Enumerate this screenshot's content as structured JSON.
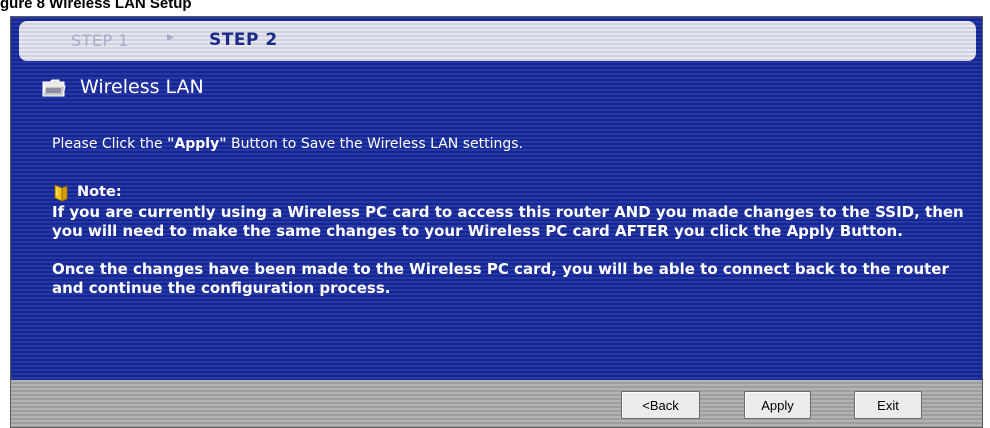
{
  "figure_caption": "gure 8 Wireless LAN Setup",
  "steps": {
    "step1_label": "STEP 1",
    "step2_label": "STEP 2"
  },
  "section": {
    "title": "Wireless LAN",
    "icon": "folder-icon"
  },
  "instruction": {
    "prefix": "Please Click the ",
    "emphasis": "\"Apply\"",
    "suffix": " Button to Save the Wireless LAN settings."
  },
  "note": {
    "icon": "note-icon",
    "label": "Note:",
    "paragraph1": "If you are currently using a Wireless PC card to access this router AND you made changes to the SSID, then you will need to make the same changes to your Wireless PC card AFTER you click the Apply Button.",
    "paragraph2": "Once the changes have been made to the Wireless PC card, you will be able to connect back to the router and continue the configuration process."
  },
  "buttons": {
    "back": "<Back",
    "apply": "Apply",
    "exit": "Exit"
  },
  "colors": {
    "panel_blue": "#1b2f9c",
    "step_active": "#1c2a8a",
    "step_inactive": "#a8acc8",
    "footer_gray": "#a9a9a9"
  }
}
